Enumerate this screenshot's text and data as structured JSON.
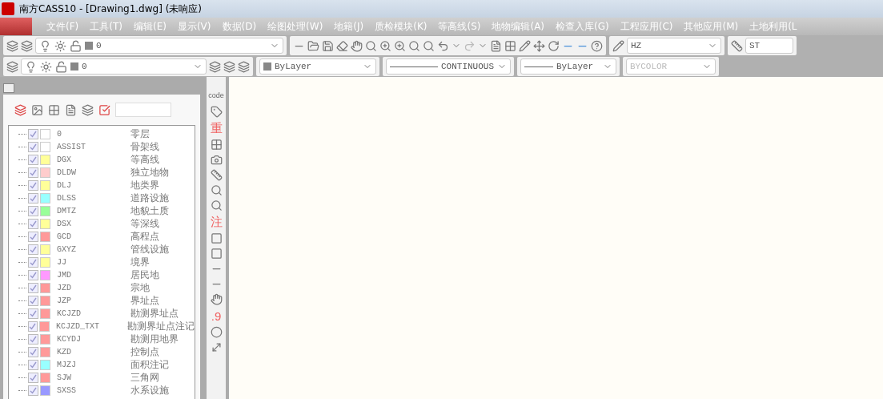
{
  "window": {
    "title": "南方CASS10 - [Drawing1.dwg] (未响应)"
  },
  "menu": [
    "文件(F)",
    "工具(T)",
    "编辑(E)",
    "显示(V)",
    "数据(D)",
    "绘图处理(W)",
    "地籍(J)",
    "质检模块(K)",
    "等高线(S)",
    "地物编辑(A)",
    "检查入库(G)",
    "工程应用(C)",
    "其他应用(M)",
    "土地利用(L"
  ],
  "toolbar1": {
    "layer_value": "0",
    "text_style": "HZ",
    "dim_style": "ST"
  },
  "toolbar2": {
    "layer_value": "0",
    "color_setting": "ByLayer",
    "linetype": "CONTINUOUS",
    "lineweight": "ByLayer",
    "plotstyle": {
      "value": "BYCOLOR",
      "disabled": true
    }
  },
  "vertical_tools": [
    {
      "kind": "text",
      "label": "code"
    },
    {
      "kind": "icon"
    },
    {
      "kind": "text",
      "label": "重"
    },
    {
      "kind": "icon"
    },
    {
      "kind": "icon"
    },
    {
      "kind": "icon"
    },
    {
      "kind": "icon"
    },
    {
      "kind": "icon"
    },
    {
      "kind": "text",
      "label": "注"
    },
    {
      "kind": "icon"
    },
    {
      "kind": "icon"
    },
    {
      "kind": "icon"
    },
    {
      "kind": "icon"
    },
    {
      "kind": "icon"
    },
    {
      "kind": "text",
      "label": ".9"
    },
    {
      "kind": "icon"
    },
    {
      "kind": "icon"
    }
  ],
  "layers": [
    {
      "name": "0",
      "description": "零层",
      "color": "#ffffff",
      "checked": true
    },
    {
      "name": "ASSIST",
      "description": "骨架线",
      "color": "#ffffff",
      "checked": true
    },
    {
      "name": "DGX",
      "description": "等高线",
      "color": "#ffff99",
      "checked": true
    },
    {
      "name": "DLDW",
      "description": "独立地物",
      "color": "#ffcccc",
      "checked": true
    },
    {
      "name": "DLJ",
      "description": "地类界",
      "color": "#ffff99",
      "checked": true
    },
    {
      "name": "DLSS",
      "description": "道路设施",
      "color": "#99ffff",
      "checked": true
    },
    {
      "name": "DMTZ",
      "description": "地貌土质",
      "color": "#99ff99",
      "checked": true
    },
    {
      "name": "DSX",
      "description": "等深线",
      "color": "#ffff99",
      "checked": true
    },
    {
      "name": "GCD",
      "description": "高程点",
      "color": "#ff9999",
      "checked": true
    },
    {
      "name": "GXYZ",
      "description": "管线设施",
      "color": "#ffff99",
      "checked": true
    },
    {
      "name": "JJ",
      "description": "境界",
      "color": "#ffff99",
      "checked": true
    },
    {
      "name": "JMD",
      "description": "居民地",
      "color": "#ff99ff",
      "checked": true
    },
    {
      "name": "JZD",
      "description": "宗地",
      "color": "#ff9999",
      "checked": true
    },
    {
      "name": "JZP",
      "description": "界址点",
      "color": "#ff9999",
      "checked": true
    },
    {
      "name": "KCJZD",
      "description": "勘测界址点",
      "color": "#ff9999",
      "checked": true
    },
    {
      "name": "KCJZD_TXT",
      "description": "勘测界址点注记",
      "color": "#ff9999",
      "checked": true
    },
    {
      "name": "KCYDJ",
      "description": "勘测用地界",
      "color": "#ff9999",
      "checked": true
    },
    {
      "name": "KZD",
      "description": "控制点",
      "color": "#ff9999",
      "checked": true
    },
    {
      "name": "MJZJ",
      "description": "面积注记",
      "color": "#99ffff",
      "checked": true
    },
    {
      "name": "SJW",
      "description": "三角网",
      "color": "#ff9999",
      "checked": true
    },
    {
      "name": "SXSS",
      "description": "水系设施",
      "color": "#9999ff",
      "checked": true
    }
  ]
}
